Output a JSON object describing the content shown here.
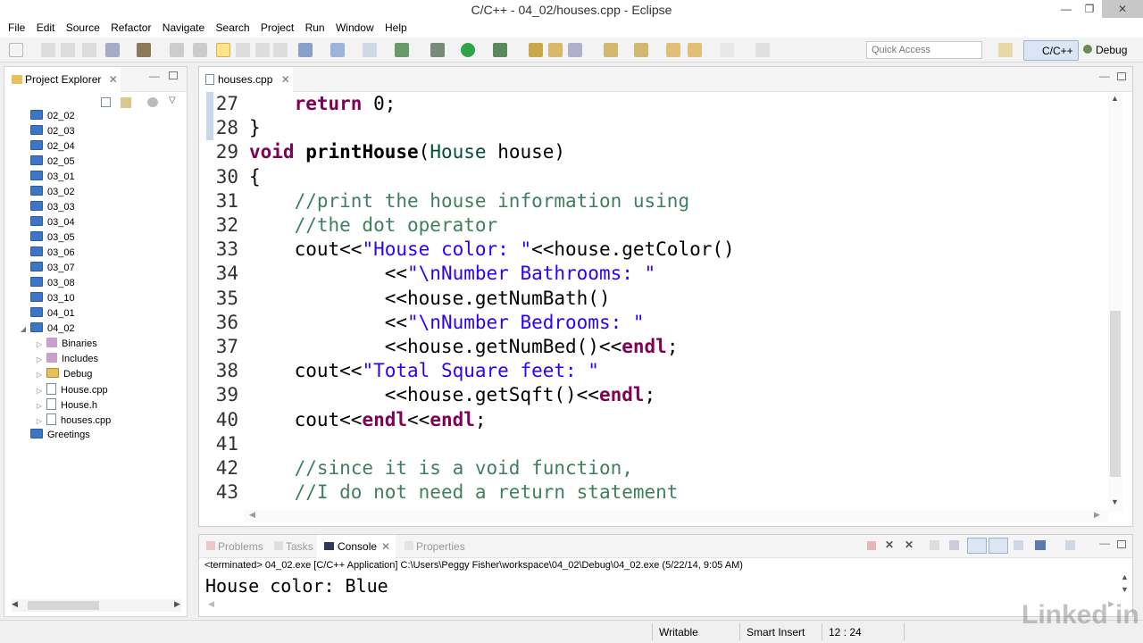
{
  "window": {
    "title": "C/C++ - 04_02/houses.cpp - Eclipse",
    "minimize": "—",
    "maximize": "❐",
    "close": "✕"
  },
  "menu": [
    "File",
    "Edit",
    "Source",
    "Refactor",
    "Navigate",
    "Search",
    "Project",
    "Run",
    "Window",
    "Help"
  ],
  "toolbar": {
    "quick_access_placeholder": "Quick Access",
    "perspective_cc": "C/C++",
    "perspective_debug": "Debug"
  },
  "project_explorer": {
    "title": "Project Explorer",
    "items": [
      {
        "label": "02_02",
        "type": "project"
      },
      {
        "label": "02_03",
        "type": "project"
      },
      {
        "label": "02_04",
        "type": "project"
      },
      {
        "label": "02_05",
        "type": "project"
      },
      {
        "label": "03_01",
        "type": "project"
      },
      {
        "label": "03_02",
        "type": "project"
      },
      {
        "label": "03_03",
        "type": "project"
      },
      {
        "label": "03_04",
        "type": "project"
      },
      {
        "label": "03_05",
        "type": "project"
      },
      {
        "label": "03_06",
        "type": "project"
      },
      {
        "label": "03_07",
        "type": "project"
      },
      {
        "label": "03_08",
        "type": "project"
      },
      {
        "label": "03_10",
        "type": "project"
      },
      {
        "label": "04_01",
        "type": "project"
      },
      {
        "label": "04_02",
        "type": "project-open"
      },
      {
        "label": "Binaries",
        "type": "child"
      },
      {
        "label": "Includes",
        "type": "child"
      },
      {
        "label": "Debug",
        "type": "child-folder"
      },
      {
        "label": "House.cpp",
        "type": "child-file"
      },
      {
        "label": "House.h",
        "type": "child-file"
      },
      {
        "label": "houses.cpp",
        "type": "child-file"
      },
      {
        "label": "Greetings",
        "type": "project"
      }
    ]
  },
  "editor": {
    "tab": "houses.cpp",
    "lines": [
      {
        "n": "27",
        "html": "    <span class='kw'>return</span> 0;"
      },
      {
        "n": "28",
        "html": "}"
      },
      {
        "n": "29",
        "html": "<span class='kw'>void</span> <span class='fn'>printHouse</span>(<span class='ty'>House</span> house)"
      },
      {
        "n": "30",
        "html": "{"
      },
      {
        "n": "31",
        "html": "    <span class='cm'>//print the house information using</span>"
      },
      {
        "n": "32",
        "html": "    <span class='cm'>//the dot operator</span>"
      },
      {
        "n": "33",
        "html": "    cout&lt;&lt;<span class='st'>\"House color: \"</span>&lt;&lt;house.getColor()"
      },
      {
        "n": "34",
        "html": "            &lt;&lt;<span class='st'>\"\\nNumber Bathrooms: \"</span>"
      },
      {
        "n": "35",
        "html": "            &lt;&lt;house.getNumBath()"
      },
      {
        "n": "36",
        "html": "            &lt;&lt;<span class='st'>\"\\nNumber Bedrooms: \"</span>"
      },
      {
        "n": "37",
        "html": "            &lt;&lt;house.getNumBed()&lt;&lt;<span class='kw'>endl</span>;"
      },
      {
        "n": "38",
        "html": "    cout&lt;&lt;<span class='st'>\"Total Square feet: \"</span>"
      },
      {
        "n": "39",
        "html": "            &lt;&lt;house.getSqft()&lt;&lt;<span class='kw'>endl</span>;"
      },
      {
        "n": "40",
        "html": "    cout&lt;&lt;<span class='kw'>endl</span>&lt;&lt;<span class='kw'>endl</span>;"
      },
      {
        "n": "41",
        "html": ""
      },
      {
        "n": "42",
        "html": "    <span class='cm'>//since it is a void function,</span>"
      },
      {
        "n": "43",
        "html": "    <span class='cm'>//I do not need a return statement</span>"
      }
    ]
  },
  "bottom": {
    "tabs": [
      "Problems",
      "Tasks",
      "Console",
      "Properties"
    ],
    "terminated": "<terminated> 04_02.exe [C/C++ Application] C:\\Users\\Peggy Fisher\\workspace\\04_02\\Debug\\04_02.exe (5/22/14, 9:05 AM)",
    "output": "House color: Blue"
  },
  "status": {
    "writable": "Writable",
    "insert_mode": "Smart Insert",
    "position": "12 : 24"
  },
  "watermark": "Linked in"
}
